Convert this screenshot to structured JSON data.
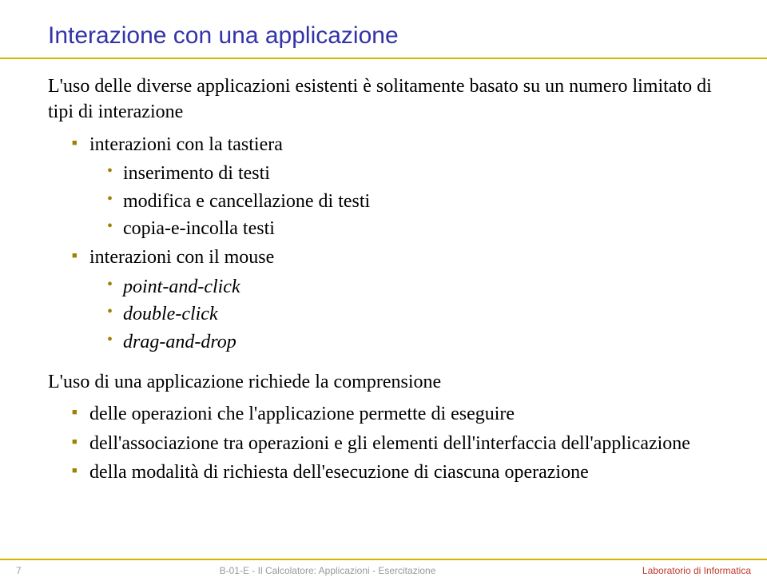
{
  "title": "Interazione con una applicazione",
  "intro1": "L'uso delle diverse applicazioni esistenti è solitamente basato su un numero limitato di tipi di interazione",
  "list1": {
    "items": [
      {
        "text": "interazioni con la tastiera",
        "sub": [
          "inserimento di testi",
          "modifica e cancellazione di testi",
          "copia-e-incolla testi"
        ]
      },
      {
        "text": "interazioni con il mouse",
        "sub_italic": [
          "point-and-click",
          "double-click",
          "drag-and-drop"
        ]
      }
    ]
  },
  "intro2": "L'uso di una applicazione richiede la comprensione",
  "list2": {
    "items": [
      "delle operazioni che l'applicazione permette di eseguire",
      "dell'associazione tra operazioni e gli elementi dell'interfaccia dell'applicazione",
      "della modalità di richiesta dell'esecuzione di ciascuna operazione"
    ]
  },
  "footer": {
    "page": "7",
    "center": "B-01-E - Il Calcolatore: Applicazioni - Esercitazione",
    "right": "Laboratorio di Informatica"
  }
}
